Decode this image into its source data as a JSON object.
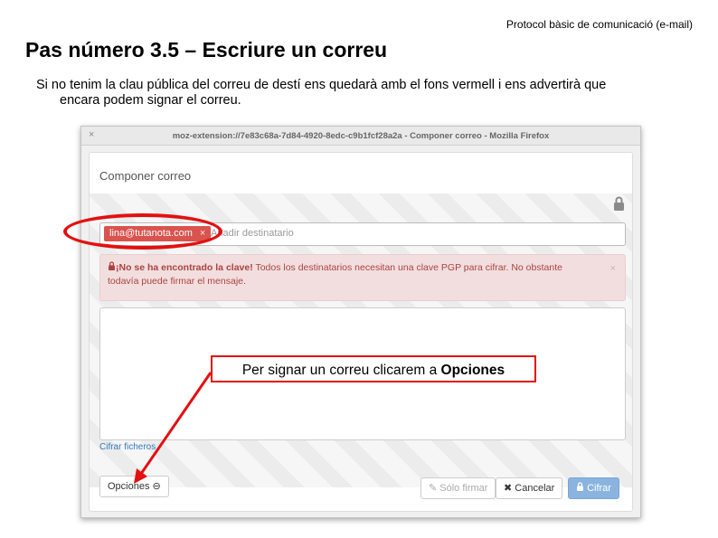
{
  "slide": {
    "header": "Protocol bàsic de comunicació (e-mail)",
    "title": "Pas número 3.5 – Escriure un correu",
    "body_line1": "Si no tenim la clau pública del correu de destí ens quedarà amb el fons vermell i ens advertirà que",
    "body_line2": "encara podem signar el correu."
  },
  "window": {
    "title": "moz-extension://7e83c68a-7d84-4920-8edc-c9b1fcf28a2a - Componer correo - Mozilla Firefox",
    "close_glyph": "×"
  },
  "compose": {
    "heading": "Componer correo",
    "recipient_tag": "lina@tutanota.com",
    "recipient_remove": "×",
    "recipient_placeholder": "Añadir destinatario",
    "alert_bold": "¡No se ha encontrado la clave!",
    "alert_text": " Todos los destinatarios necesitan una clave PGP para cifrar. No obstante todavía puede firmar el mensaje.",
    "alert_close": "×",
    "encrypt_files": "Cifrar ficheros",
    "btn_options": "Opciones",
    "btn_sign": "Sólo firmar",
    "btn_cancel": "Cancelar",
    "btn_encrypt": "Cifrar"
  },
  "annotation": {
    "text": "Per signar un correu clicarem a ",
    "highlight": "Opciones",
    "color": "#e31010"
  },
  "colors": {
    "alert_bg": "#f2dede",
    "alert_text": "#a94442",
    "tag_bg": "#d9534f",
    "primary_btn": "#8ab4df"
  }
}
